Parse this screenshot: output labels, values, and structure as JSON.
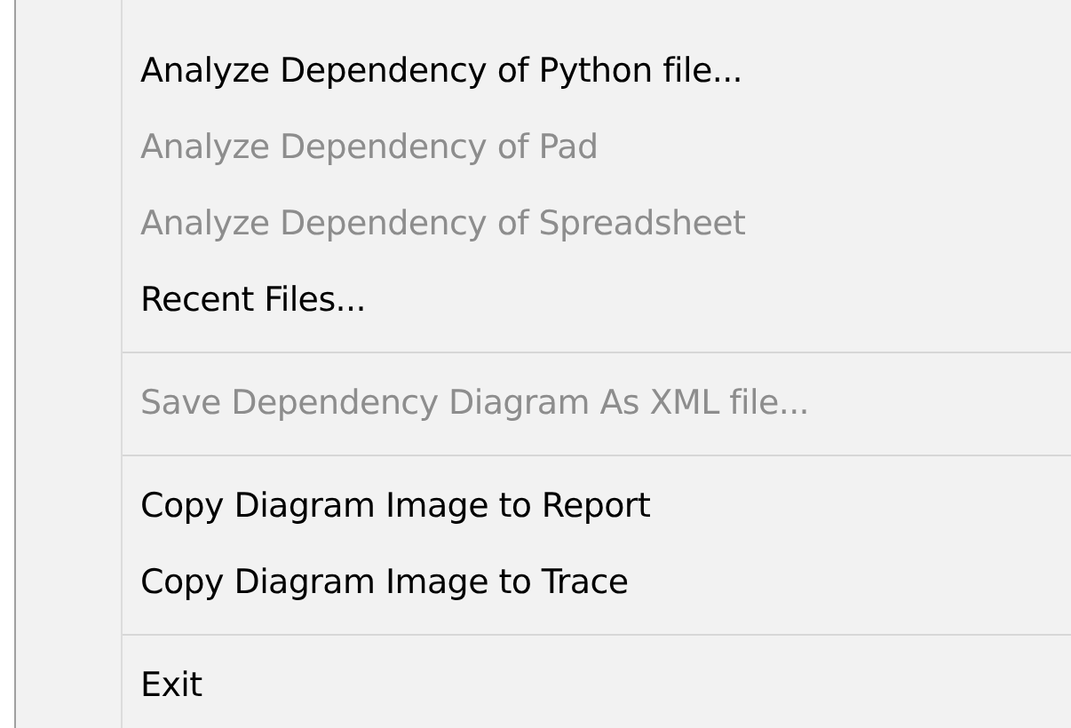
{
  "menu": {
    "items": [
      {
        "kind": "item",
        "label": "Analyze Dependency of Python file...",
        "disabled": false
      },
      {
        "kind": "item",
        "label": "Analyze Dependency of Pad",
        "disabled": true
      },
      {
        "kind": "item",
        "label": "Analyze Dependency of Spreadsheet",
        "disabled": true
      },
      {
        "kind": "item",
        "label": "Recent Files...",
        "disabled": false
      },
      {
        "kind": "separator"
      },
      {
        "kind": "item",
        "label": "Save Dependency Diagram As XML file...",
        "disabled": true
      },
      {
        "kind": "separator"
      },
      {
        "kind": "item",
        "label": "Copy Diagram Image to Report",
        "disabled": false
      },
      {
        "kind": "item",
        "label": "Copy Diagram Image to Trace",
        "disabled": false
      },
      {
        "kind": "separator"
      },
      {
        "kind": "item",
        "label": "Exit",
        "disabled": false
      }
    ]
  }
}
